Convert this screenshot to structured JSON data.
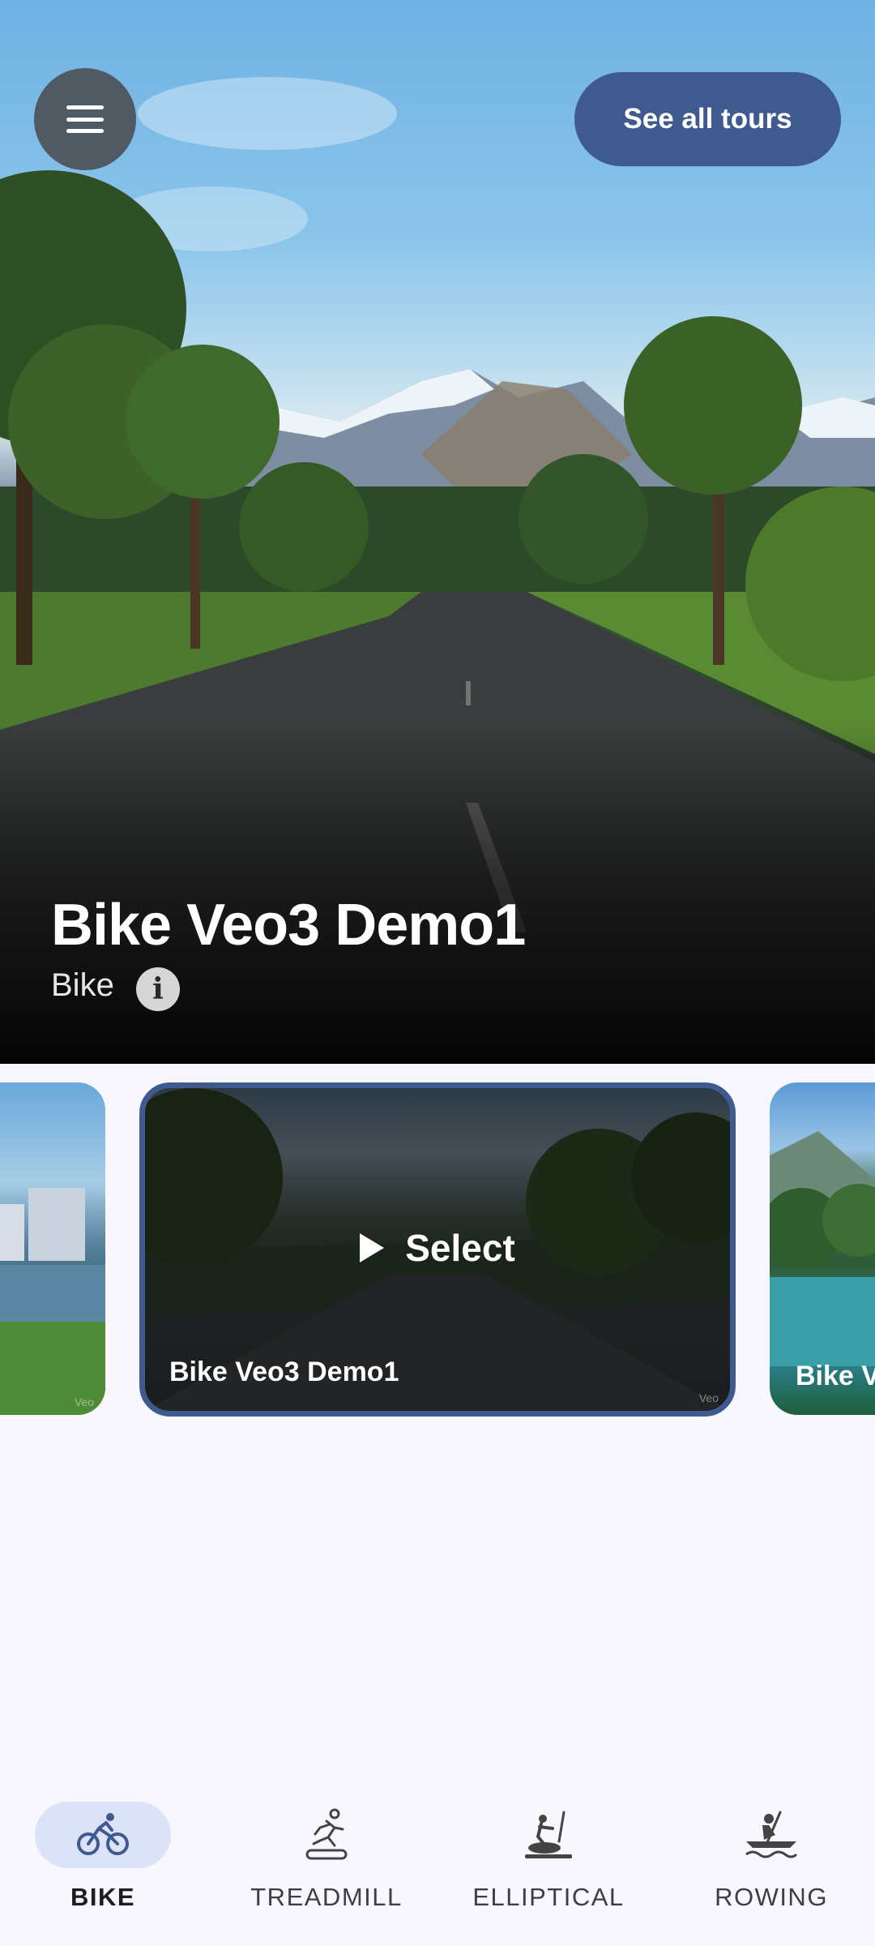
{
  "header": {
    "menu_icon": "hamburger-icon",
    "see_all_tours_label": "See all tours"
  },
  "hero": {
    "title": "Bike Veo3 Demo1",
    "category": "Bike",
    "info_icon": "info-icon",
    "info_glyph": "i"
  },
  "carousel": {
    "cards": [
      {
        "title": "",
        "watermark": "Veo"
      },
      {
        "title": "Bike Veo3 Demo1",
        "watermark": "Veo",
        "action_label": "Select",
        "selected": true
      },
      {
        "title": "Bike V",
        "watermark": ""
      }
    ]
  },
  "bottom_nav": {
    "items": [
      {
        "label": "BIKE",
        "icon": "bike-icon",
        "active": true
      },
      {
        "label": "TREADMILL",
        "icon": "treadmill-icon",
        "active": false
      },
      {
        "label": "ELLIPTICAL",
        "icon": "elliptical-icon",
        "active": false
      },
      {
        "label": "ROWING",
        "icon": "rowing-icon",
        "active": false
      }
    ]
  },
  "colors": {
    "accent": "#3f5a8f",
    "nav_active_pill": "#dce3f8",
    "background": "#f8f7fd",
    "menu_button": "#505a63"
  }
}
